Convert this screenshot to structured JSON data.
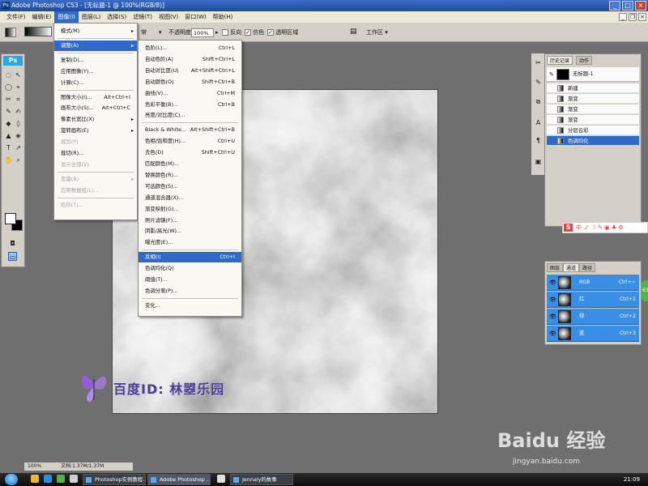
{
  "window": {
    "title": "Adobe Photoshop CS3 - [无标题-1 @ 100%(RGB/8)]",
    "min": "_",
    "max": "□",
    "close": "×"
  },
  "menubar": [
    "文件(F)",
    "编辑(E)",
    "图像(I)",
    "图层(L)",
    "选择(S)",
    "滤镜(T)",
    "视图(V)",
    "窗口(W)",
    "帮助(H)"
  ],
  "options": {
    "mode_partial": "常",
    "opacity_label": "不透明度:",
    "opacity_value": "100%",
    "reverse": "反向",
    "dither": "仿色",
    "transparency": "透明区域",
    "workspace": "工作区 ▾"
  },
  "image_menu": [
    {
      "label": "模式(M)",
      "arrow": true
    },
    {
      "sep": true
    },
    {
      "label": "调整(A)",
      "arrow": true,
      "highlight": true
    },
    {
      "sep": true
    },
    {
      "label": "复制(D)..."
    },
    {
      "label": "应用图像(Y)..."
    },
    {
      "label": "计算(C)..."
    },
    {
      "sep": true
    },
    {
      "label": "图像大小(I)...",
      "shortcut": "Alt+Ctrl+I"
    },
    {
      "label": "画布大小(S)...",
      "shortcut": "Alt+Ctrl+C"
    },
    {
      "label": "像素长宽比(X)",
      "arrow": true
    },
    {
      "label": "旋转画布(E)",
      "arrow": true
    },
    {
      "label": "裁剪(P)",
      "disabled": true
    },
    {
      "label": "裁切(R)..."
    },
    {
      "label": "显示全部(V)",
      "disabled": true
    },
    {
      "sep": true
    },
    {
      "label": "变量(B)",
      "arrow": true,
      "disabled": true
    },
    {
      "label": "应用数据组(L)...",
      "disabled": true
    },
    {
      "sep": true
    },
    {
      "label": "陷印(T)...",
      "disabled": true
    }
  ],
  "adjust_menu": [
    {
      "label": "色阶(L)...",
      "shortcut": "Ctrl+L"
    },
    {
      "label": "自动色阶(A)",
      "shortcut": "Shift+Ctrl+L"
    },
    {
      "label": "自动对比度(U)",
      "shortcut": "Alt+Shift+Ctrl+L"
    },
    {
      "label": "自动颜色(O)",
      "shortcut": "Shift+Ctrl+B"
    },
    {
      "label": "曲线(V)...",
      "shortcut": "Ctrl+M"
    },
    {
      "label": "色彩平衡(B)...",
      "shortcut": "Ctrl+B"
    },
    {
      "label": "亮度/对比度(C)..."
    },
    {
      "sep": true
    },
    {
      "label": "Black & White...",
      "shortcut": "Alt+Shift+Ctrl+B"
    },
    {
      "label": "色相/饱和度(H)...",
      "shortcut": "Ctrl+U"
    },
    {
      "label": "去色(D)",
      "shortcut": "Shift+Ctrl+U"
    },
    {
      "label": "匹配颜色(M)..."
    },
    {
      "label": "替换颜色(R)..."
    },
    {
      "label": "可选颜色(S)..."
    },
    {
      "label": "通道混合器(X)..."
    },
    {
      "label": "渐变映射(G)..."
    },
    {
      "label": "照片滤镜(F)..."
    },
    {
      "label": "阴影/高光(W)..."
    },
    {
      "label": "曝光度(E)..."
    },
    {
      "sep": true
    },
    {
      "label": "反相(I)",
      "shortcut": "Ctrl+I",
      "highlight": true
    },
    {
      "label": "色调均化(Q)"
    },
    {
      "label": "阈值(T)..."
    },
    {
      "label": "色调分离(P)..."
    },
    {
      "sep": true
    },
    {
      "label": "变化..."
    }
  ],
  "history": {
    "tabs": [
      "历史记录",
      "动作"
    ],
    "snapshot": "无标题-1",
    "items": [
      "新建",
      "渐变",
      "渐变",
      "渐变",
      "分层云彩",
      "色调均化"
    ],
    "selected_index": 5
  },
  "channels": {
    "tabs": [
      "图层",
      "通道",
      "路径"
    ],
    "items": [
      {
        "name": "RGB",
        "shortcut": "Ctrl+~"
      },
      {
        "name": "红",
        "shortcut": "Ctrl+1"
      },
      {
        "name": "绿",
        "shortcut": "Ctrl+2"
      },
      {
        "name": "蓝",
        "shortcut": "Ctrl+3"
      }
    ]
  },
  "status": {
    "zoom": "100%",
    "doc": "文档:1.37M/1.37M"
  },
  "watermark": "百度ID: 林曌乐园",
  "baidu": {
    "logo": "Baidu 经验",
    "url": "jingyan.baidu.com"
  },
  "taskbar": {
    "apps": [
      "Photoshop实例教程...",
      "Adobe Photoshop ...",
      "Jennaly的故事"
    ],
    "clock": "21:09"
  },
  "ime_text": "中 ノ ☽ ✎ ▣ ♣ ⚙",
  "side_badge": "63"
}
